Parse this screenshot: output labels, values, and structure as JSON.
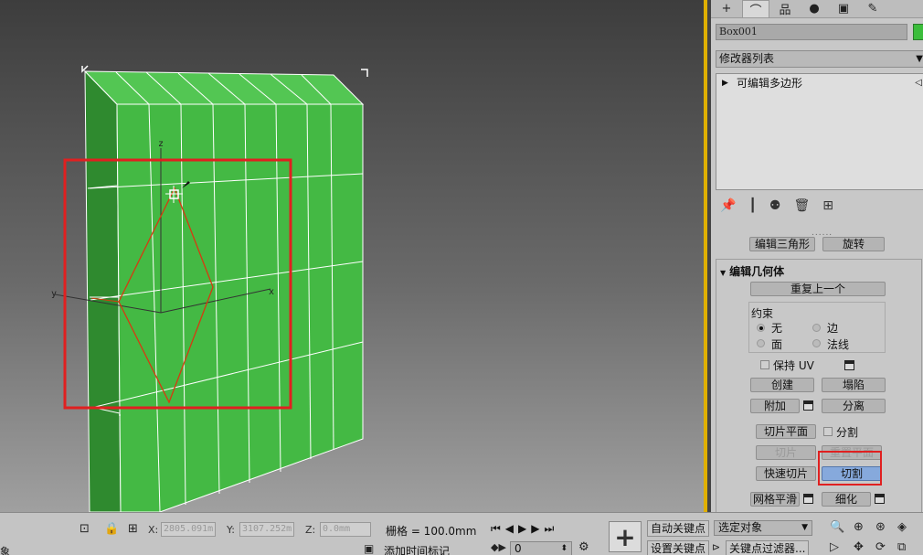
{
  "viewport": {
    "axis_labels": {
      "x": "x",
      "y": "y",
      "z": "z"
    },
    "object_color": "#43b843",
    "edge_color": "#ffffff",
    "cut_line_color": "#d63a10",
    "highlight_color": "#e02020"
  },
  "command_panel": {
    "tabs": [
      "+",
      "⌒",
      "品",
      "●",
      "▣",
      "✎"
    ],
    "object_name": "Box001",
    "object_color": "#3bbd3b",
    "modifier_list_label": "修改器列表",
    "stack_item": "可编辑多边形",
    "stack_tools": [
      "📌",
      "┃",
      "⚉",
      "🗑",
      "⊞"
    ],
    "separator": "......",
    "prev_rollout_buttons": [
      "编辑三角形",
      "旋转"
    ],
    "edit_geometry": {
      "title": "编辑几何体",
      "repeat_last": "重复上一个",
      "constraint_label": "约束",
      "constraints": {
        "none": "无",
        "edge": "边",
        "face": "面",
        "normal": "法线"
      },
      "preserve_uv": "保持 UV",
      "create": "创建",
      "collapse": "塌陷",
      "attach": "附加",
      "detach": "分离",
      "slice_plane": "切片平面",
      "split": "分割",
      "slice": "切片",
      "reset_plane": "重置平面",
      "quickslice": "快速切片",
      "cut": "切割",
      "meshsmooth": "网格平滑",
      "tessellate": "细化"
    }
  },
  "status_bar": {
    "left_text": "象",
    "coord_labels": {
      "x": "X:",
      "y": "Y:",
      "z": "Z:"
    },
    "coord_values": {
      "x": "2805.091m",
      "y": "3107.252m",
      "z": "0.0mm"
    },
    "grid_text": "栅格 = 100.0mm",
    "add_time_tag": "添加时间标记",
    "auto_key": "自动关键点",
    "set_key": "设置关键点",
    "selected_object": "选定对象",
    "key_filters": "关键点过滤器...",
    "frame_value": "0",
    "playback_controls": "⏮◀▶▶⏭"
  }
}
